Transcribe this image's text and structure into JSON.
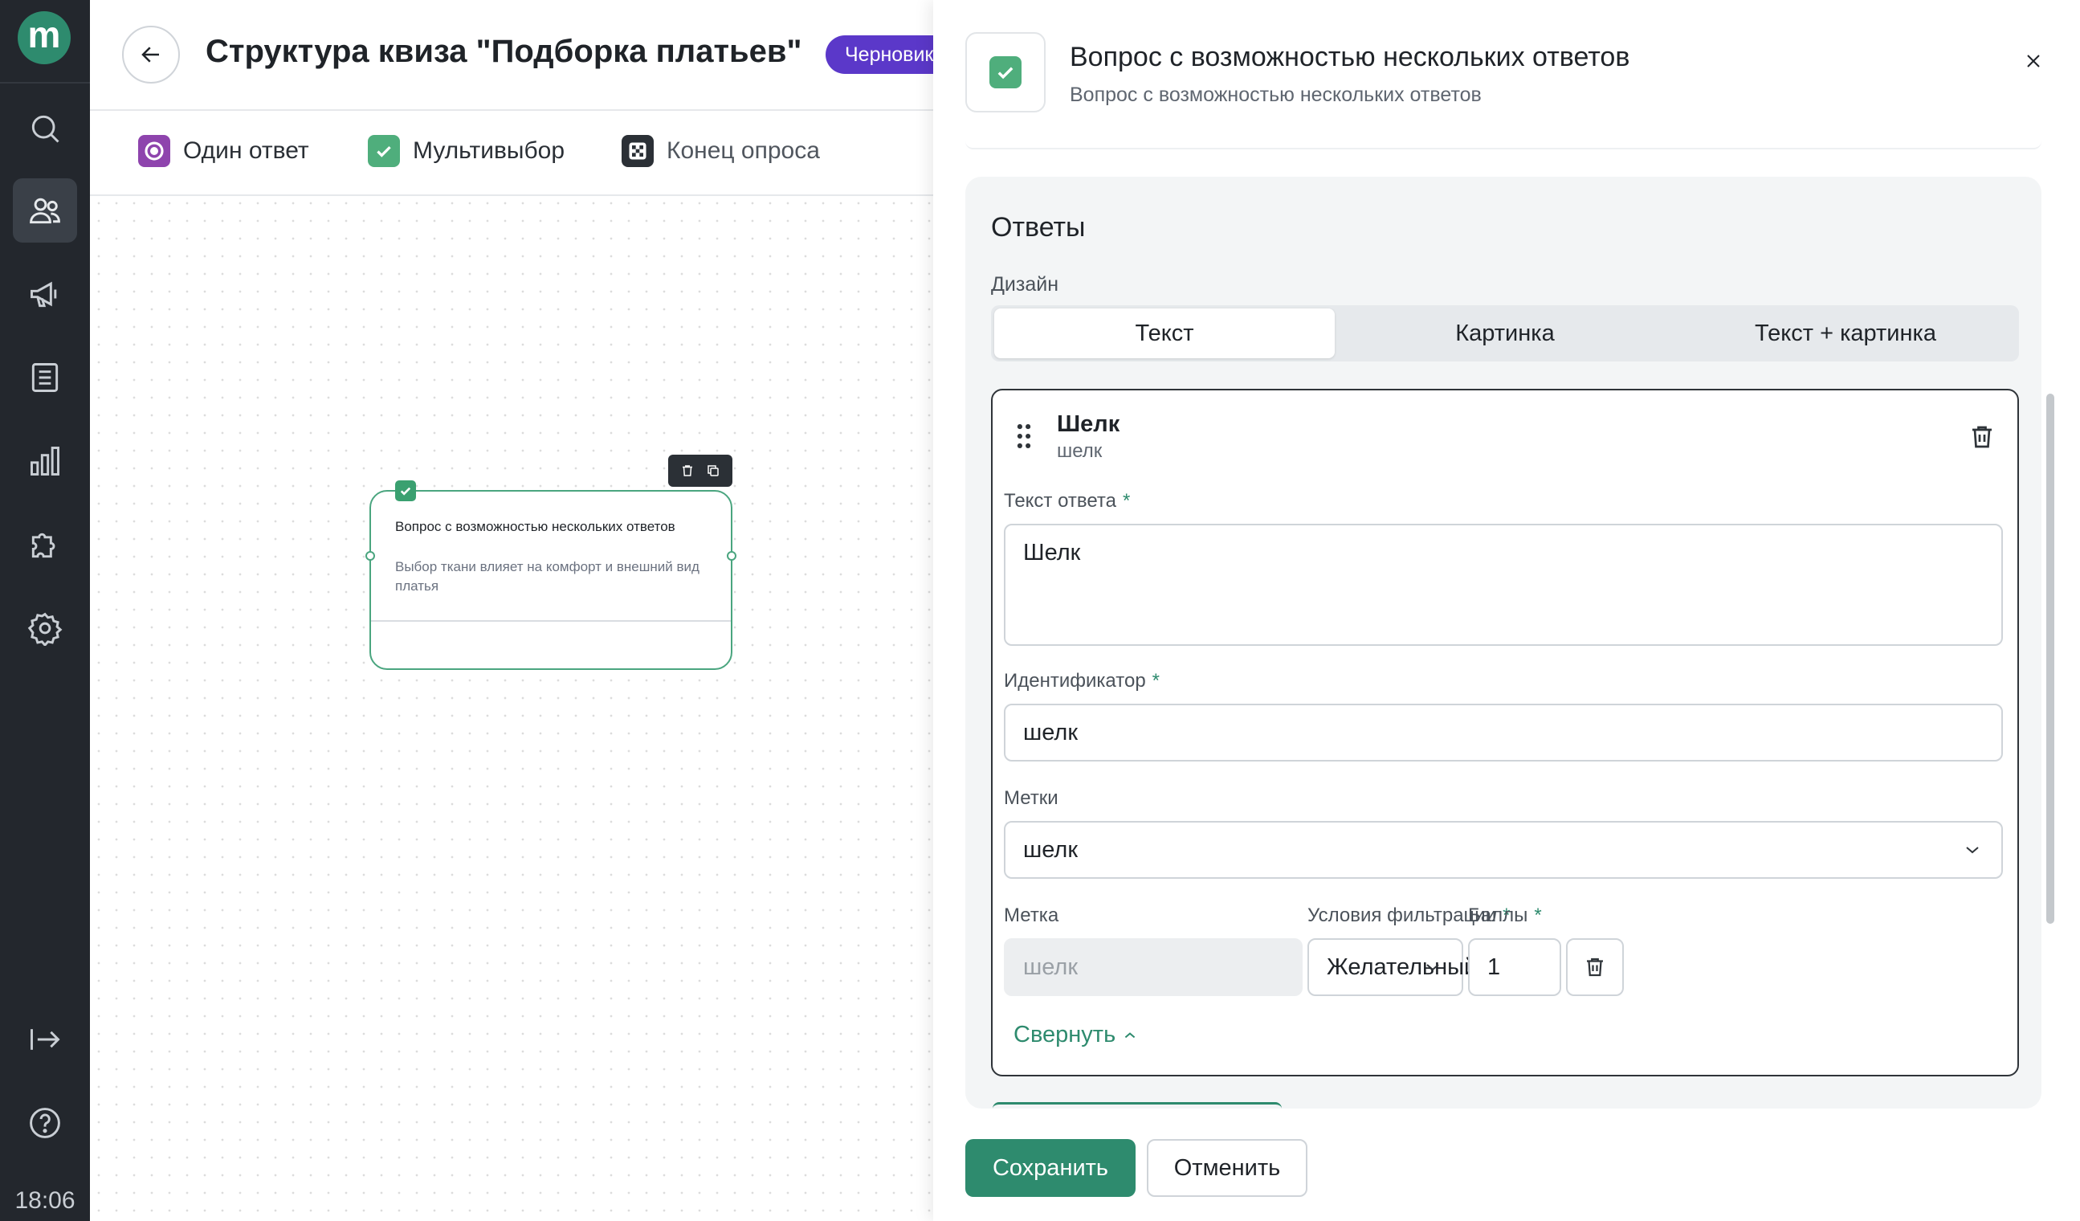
{
  "sidebar": {
    "logo": "m",
    "time": "18:06",
    "items": [
      {
        "icon": "search-icon"
      },
      {
        "icon": "users-icon",
        "active": true
      },
      {
        "icon": "megaphone-icon"
      },
      {
        "icon": "document-icon"
      },
      {
        "icon": "bar-chart-icon"
      },
      {
        "icon": "puzzle-icon"
      },
      {
        "icon": "gear-icon"
      }
    ],
    "bottom": [
      {
        "icon": "logout-icon"
      },
      {
        "icon": "help-icon"
      }
    ]
  },
  "header": {
    "title": "Структура квиза \"Подборка платьев\"",
    "status_badge": "Черновик"
  },
  "toolbar": {
    "single": "Один ответ",
    "multi": "Мультивыбор",
    "end": "Конец опроса"
  },
  "node": {
    "title": "Вопрос с возможностью нескольких ответов",
    "subtitle": "Выбор ткани влияет на комфорт и внешний вид платья"
  },
  "drawer": {
    "title": "Вопрос с возможностью нескольких ответов",
    "subtitle": "Вопрос с возможностью нескольких ответов",
    "answers": {
      "heading": "Ответы",
      "design_label": "Дизайн",
      "design_options": [
        "Текст",
        "Картинка",
        "Текст + картинка"
      ],
      "design_selected": "Текст",
      "answer": {
        "title": "Шелк",
        "subtitle": "шелк",
        "text_label": "Текст ответа",
        "text_value": "Шелк",
        "id_label": "Идентификатор",
        "id_value": "шелк",
        "tags_label": "Метки",
        "tags_value": "шелк",
        "tag_label": "Метка",
        "tag_value": "шелк",
        "filter_label": "Условия фильтрации",
        "filter_value": "Желательный",
        "points_label": "Баллы",
        "points_value": "1",
        "required_mark": "*",
        "collapse": "Свернуть"
      }
    },
    "save": "Сохранить",
    "cancel": "Отменить"
  },
  "colors": {
    "accent": "#2e8b6e",
    "sidebar_bg": "#23272d",
    "badge": "#5b38c9",
    "single_icon": "#8e44ad",
    "multi_icon": "#4fae7c"
  }
}
